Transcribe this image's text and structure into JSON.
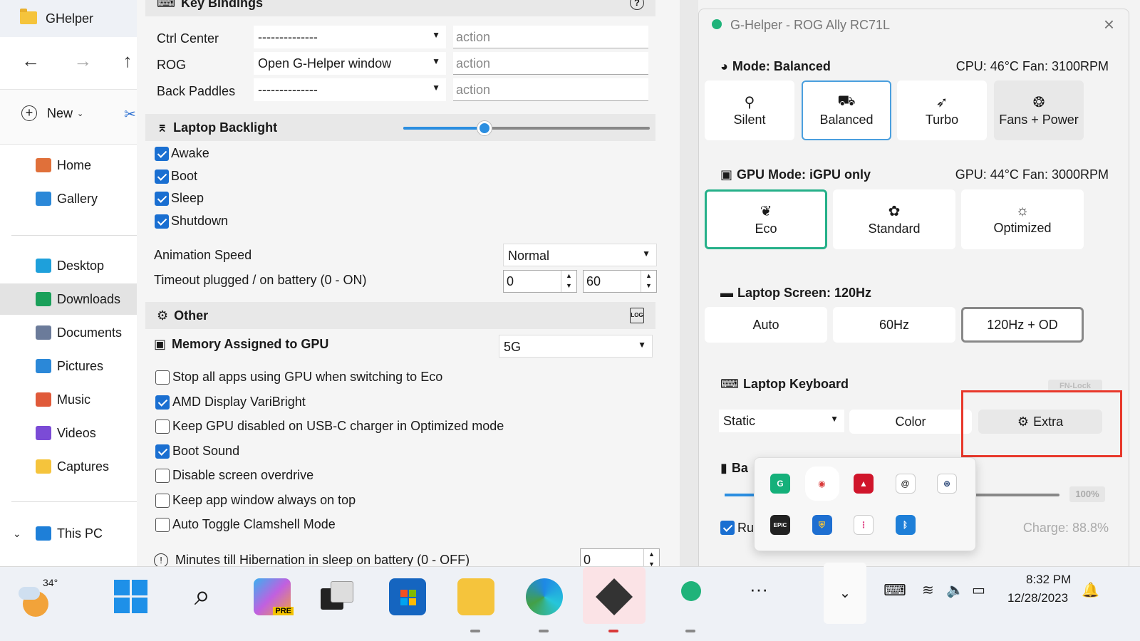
{
  "explorer": {
    "title": "GHelper",
    "new_label": "New",
    "sidebar": [
      {
        "label": "Home",
        "icon": "home-icon",
        "color": "#e0703a"
      },
      {
        "label": "Gallery",
        "icon": "gallery-icon",
        "color": "#2b88d8"
      },
      {
        "label": "Desktop",
        "icon": "desktop-icon",
        "color": "#1ea0db"
      },
      {
        "label": "Downloads",
        "icon": "download-icon",
        "color": "#1aa05a"
      },
      {
        "label": "Documents",
        "icon": "documents-icon",
        "color": "#6b7b9a"
      },
      {
        "label": "Pictures",
        "icon": "pictures-icon",
        "color": "#2b88d8"
      },
      {
        "label": "Music",
        "icon": "music-icon",
        "color": "#e05a3a"
      },
      {
        "label": "Videos",
        "icon": "videos-icon",
        "color": "#7b4bd6"
      },
      {
        "label": "Captures",
        "icon": "folder-icon",
        "color": "#f5c43c"
      },
      {
        "label": "This PC",
        "icon": "pc-icon",
        "color": "#1e7fd8"
      }
    ]
  },
  "settings": {
    "keybindings": {
      "header": "Key Bindings",
      "rows": [
        {
          "label": "Ctrl Center",
          "value": "--------------",
          "action_placeholder": "action"
        },
        {
          "label": "ROG",
          "value": "Open G-Helper window",
          "action_placeholder": "action"
        },
        {
          "label": "Back Paddles",
          "value": "--------------",
          "action_placeholder": "action"
        }
      ]
    },
    "backlight": {
      "header": "Laptop Backlight",
      "slider_fraction": 0.33,
      "checks": [
        {
          "label": "Awake",
          "checked": true
        },
        {
          "label": "Boot",
          "checked": true
        },
        {
          "label": "Sleep",
          "checked": true
        },
        {
          "label": "Shutdown",
          "checked": true
        }
      ],
      "anim_label": "Animation Speed",
      "anim_value": "Normal",
      "timeout_label": "Timeout plugged / on battery (0 - ON)",
      "timeout_plugged": "0",
      "timeout_battery": "60"
    },
    "other": {
      "header": "Other",
      "log_label": "LOG",
      "memory_label": "Memory Assigned to GPU",
      "memory_value": "5G",
      "checks": [
        {
          "label": "Stop all apps using GPU when switching to Eco",
          "checked": false
        },
        {
          "label": "AMD Display VariBright",
          "checked": true
        },
        {
          "label": "Keep GPU disabled on USB-C charger in Optimized mode",
          "checked": false
        },
        {
          "label": "Boot Sound",
          "checked": true
        },
        {
          "label": "Disable screen overdrive",
          "checked": false
        },
        {
          "label": "Keep app window always on top",
          "checked": false
        },
        {
          "label": "Auto Toggle Clamshell Mode",
          "checked": false
        }
      ],
      "hibernation_label": "Minutes till Hibernation in sleep on battery (0 - OFF)",
      "hibernation_value": "0"
    }
  },
  "main": {
    "title": "G-Helper - ROG Ally RC71L",
    "mode": {
      "header": "Mode: Balanced",
      "status": "CPU: 46°C Fan: 3100RPM",
      "buttons": [
        "Silent",
        "Balanced",
        "Turbo",
        "Fans + Power"
      ]
    },
    "gpu": {
      "header": "GPU Mode: iGPU only",
      "status": "GPU: 44°C Fan: 3000RPM",
      "buttons": [
        "Eco",
        "Standard",
        "Optimized"
      ]
    },
    "screen": {
      "header": "Laptop Screen: 120Hz",
      "buttons": [
        "Auto",
        "60Hz",
        "120Hz + OD"
      ]
    },
    "keyboard": {
      "header": "Laptop Keyboard",
      "fnlock": "FN-Lock",
      "mode_value": "Static",
      "color_label": "Color",
      "extra_label": "Extra"
    },
    "battery": {
      "header_partial": "Ba",
      "percent": "100%",
      "checkbox_partial": "Ru",
      "charge": "Charge: 88.8%"
    },
    "highlight_color": "#e8382b"
  },
  "tray": {
    "icons": [
      "grammarly-icon",
      "chrome-canary-icon",
      "amd-icon",
      "armoury-crate-icon",
      "steam-icon",
      "epic-games-icon",
      "defender-warning-icon",
      "voice-icon",
      "bluetooth-icon"
    ]
  },
  "taskbar": {
    "weather_temp": "34°",
    "copilot_badge": "PRE",
    "time": "8:32 PM",
    "date": "12/28/2023"
  }
}
